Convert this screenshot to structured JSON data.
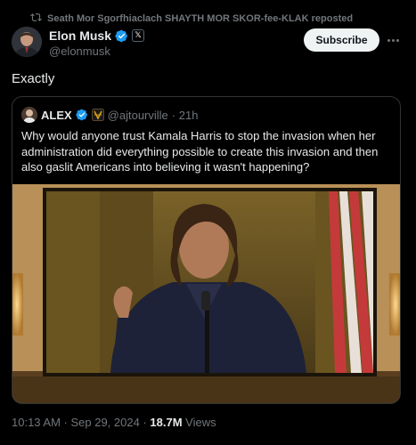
{
  "repost": {
    "text": "Seath Mor Sgorfhiaclach SHAYTH MOR SKOR-fee-KLAK reposted"
  },
  "post": {
    "author_name": "Elon Musk",
    "author_handle": "@elonmusk",
    "subscribe_label": "Subscribe",
    "text": "Exactly",
    "timestamp": "10:13 AM · Sep 29, 2024 · ",
    "views_count": "18.7M",
    "views_label": " Views"
  },
  "quote": {
    "author_name": "ALEX",
    "author_handle": "@ajtourville",
    "time": "· 21h",
    "text": "Why would anyone trust Kamala Harris to stop the invasion when her administration did everything possible to create this invasion and then also gaslit Americans into believing it wasn't happening?"
  },
  "icons": {
    "repost": "repost-icon",
    "verified": "verified-badge-icon",
    "x_affiliate": "x-logo-icon",
    "more": "more-options-icon",
    "affiliate_badge": "affiliate-badge-icon"
  },
  "colors": {
    "background": "#000000",
    "text_primary": "#e7e9ea",
    "text_secondary": "#71767b",
    "verified_blue": "#1d9bf0",
    "subscribe_bg": "#eff3f4",
    "border": "#2f3336"
  }
}
